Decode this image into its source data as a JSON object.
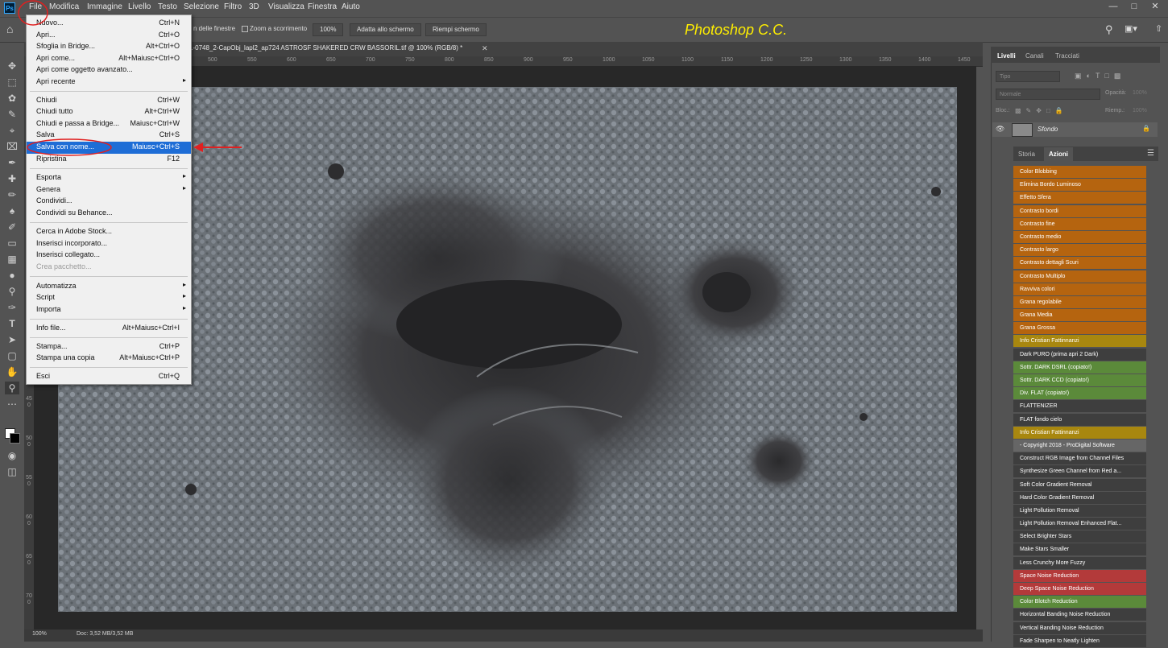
{
  "menubar": {
    "items": [
      "File",
      "Modifica",
      "Immagine",
      "Livello",
      "Testo",
      "Selezione",
      "Filtro",
      "3D",
      "Visualizza",
      "Finestra",
      "Aiuto"
    ]
  },
  "optionsbar": {
    "scroll_all_windows": "n delle finestre",
    "scrubby_zoom": "Zoom a scorrimento",
    "zoom_value": "100%",
    "fit_screen": "Adatta allo schermo",
    "fill_screen": "Riempi schermo"
  },
  "watermark": "Photoshop C.C.",
  "document": {
    "tab_label": "1-0748_2-CapObj_lapl2_ap724 ASTROSF SHAKERED CRW BASSORIL.tif @ 100% (RGB/8) *",
    "ruler_ticks": [
      "300",
      "350",
      "400",
      "450",
      "500",
      "550",
      "600",
      "650",
      "700",
      "750",
      "800",
      "850",
      "900",
      "950",
      "1000",
      "1050",
      "1100",
      "1150",
      "1200",
      "1250",
      "1300",
      "1350",
      "1400",
      "1450"
    ],
    "vruler_ticks": [
      "50",
      "100",
      "150",
      "200",
      "250",
      "300",
      "350",
      "400",
      "450",
      "500",
      "550",
      "600",
      "650",
      "700"
    ]
  },
  "status": {
    "zoom": "100%",
    "doc_info": "Doc: 3,52 MB/3,52 MB"
  },
  "file_menu": {
    "items": [
      {
        "label": "Nuovo...",
        "shortcut": "Ctrl+N"
      },
      {
        "label": "Apri...",
        "shortcut": "Ctrl+O"
      },
      {
        "label": "Sfoglia in Bridge...",
        "shortcut": "Alt+Ctrl+O"
      },
      {
        "label": "Apri come...",
        "shortcut": "Alt+Maiusc+Ctrl+O"
      },
      {
        "label": "Apri come oggetto avanzato...",
        "shortcut": ""
      },
      {
        "label": "Apri recente",
        "shortcut": ""
      },
      {
        "label": "Chiudi",
        "shortcut": "Ctrl+W"
      },
      {
        "label": "Chiudi tutto",
        "shortcut": "Alt+Ctrl+W"
      },
      {
        "label": "Chiudi e passa a Bridge...",
        "shortcut": "Maiusc+Ctrl+W"
      },
      {
        "label": "Salva",
        "shortcut": "Ctrl+S"
      },
      {
        "label": "Salva con nome...",
        "shortcut": "Maiusc+Ctrl+S"
      },
      {
        "label": "Ripristina",
        "shortcut": "F12"
      },
      {
        "label": "Esporta",
        "shortcut": ""
      },
      {
        "label": "Genera",
        "shortcut": ""
      },
      {
        "label": "Condividi...",
        "shortcut": ""
      },
      {
        "label": "Condividi su Behance...",
        "shortcut": ""
      },
      {
        "label": "Cerca in Adobe Stock...",
        "shortcut": ""
      },
      {
        "label": "Inserisci incorporato...",
        "shortcut": ""
      },
      {
        "label": "Inserisci collegato...",
        "shortcut": ""
      },
      {
        "label": "Crea pacchetto...",
        "shortcut": ""
      },
      {
        "label": "Automatizza",
        "shortcut": ""
      },
      {
        "label": "Script",
        "shortcut": ""
      },
      {
        "label": "Importa",
        "shortcut": ""
      },
      {
        "label": "Info file...",
        "shortcut": "Alt+Maiusc+Ctrl+I"
      },
      {
        "label": "Stampa...",
        "shortcut": "Ctrl+P"
      },
      {
        "label": "Stampa una copia",
        "shortcut": "Alt+Maiusc+Ctrl+P"
      },
      {
        "label": "Esci",
        "shortcut": "Ctrl+Q"
      }
    ]
  },
  "layers_panel": {
    "tabs": [
      "Livelli",
      "Canali",
      "Tracciati"
    ],
    "search_placeholder": "Tipo",
    "blend_mode": "Normale",
    "opacity_label": "Opacità:",
    "opacity_value": "100%",
    "lock_label": "Bloc.:",
    "fill_label": "Riemp.:",
    "fill_value": "100%",
    "layer_name": "Sfondo"
  },
  "actions_panel": {
    "tabs": [
      "Storia",
      "Azioni"
    ],
    "items": [
      {
        "label": "Color Blobbing",
        "color": "#b5640f"
      },
      {
        "label": "Elimina Bordo Luminoso",
        "color": "#b5640f"
      },
      {
        "label": "Effetto Sfera",
        "color": "#b5640f"
      },
      {
        "label": "Contrasto bordi",
        "color": "#b5640f"
      },
      {
        "label": "Contrasto fine",
        "color": "#b5640f"
      },
      {
        "label": "Contrasto medio",
        "color": "#b5640f"
      },
      {
        "label": "Contrasto largo",
        "color": "#b5640f"
      },
      {
        "label": "Contrasto dettagli Scuri",
        "color": "#b5640f"
      },
      {
        "label": "Contrasto Multiplo",
        "color": "#b5640f"
      },
      {
        "label": "Ravviva colori",
        "color": "#b5640f"
      },
      {
        "label": "Grana regolabile",
        "color": "#b5640f"
      },
      {
        "label": "Grana Media",
        "color": "#b5640f"
      },
      {
        "label": "Grana Grossa",
        "color": "#b5640f"
      },
      {
        "label": "Info Cristian Fattinnanzi",
        "color": "#a8870f"
      },
      {
        "label": "Dark PURO (prima apri 2 Dark)",
        "color": "#3e3e3e"
      },
      {
        "label": "Sottr. DARK DSRL (copiato!)",
        "color": "#5b8a3a"
      },
      {
        "label": "Sottr. DARK CCD (copiato!)",
        "color": "#5b8a3a"
      },
      {
        "label": "Div. FLAT (copiato!)",
        "color": "#5b8a3a"
      },
      {
        "label": "FLATTENIZER",
        "color": "#3e3e3e"
      },
      {
        "label": "FLAT fondo cielo",
        "color": "#3e3e3e"
      },
      {
        "label": "Info Cristian Fattinnanzi",
        "color": "#a8870f"
      },
      {
        "label": "- Copyright 2018 - ProDigital Software",
        "color": "#666666"
      },
      {
        "label": "Construct RGB Image from Channel Files",
        "color": "#3e3e3e"
      },
      {
        "label": "Synthesize Green Channel from Red a...",
        "color": "#3e3e3e"
      },
      {
        "label": "Soft Color Gradient Removal",
        "color": "#3e3e3e"
      },
      {
        "label": "Hard Color Gradient Removal",
        "color": "#3e3e3e"
      },
      {
        "label": "Light Pollution Removal",
        "color": "#3e3e3e"
      },
      {
        "label": "Light Pollution Removal Enhanced Flat...",
        "color": "#3e3e3e"
      },
      {
        "label": "Select Brighter Stars",
        "color": "#3e3e3e"
      },
      {
        "label": "Make Stars Smaller",
        "color": "#3e3e3e"
      },
      {
        "label": "Less Crunchy More Fuzzy",
        "color": "#3e3e3e"
      },
      {
        "label": "Space Noise Reduction",
        "color": "#b33a3a"
      },
      {
        "label": "Deep Space Noise Reduction",
        "color": "#b33a3a"
      },
      {
        "label": "Color Blotch Reduction",
        "color": "#5b8a3a"
      },
      {
        "label": "Horizontal Banding Noise Reduction",
        "color": "#3e3e3e"
      },
      {
        "label": "Vertical Banding Noise Reduction",
        "color": "#3e3e3e"
      },
      {
        "label": "Fade Sharpen to Neatly Lighten",
        "color": "#3e3e3e"
      }
    ]
  },
  "colors": {
    "annotation_red": "#e02020",
    "menu_highlight": "#1e6dd6",
    "watermark": "#ffee00"
  }
}
